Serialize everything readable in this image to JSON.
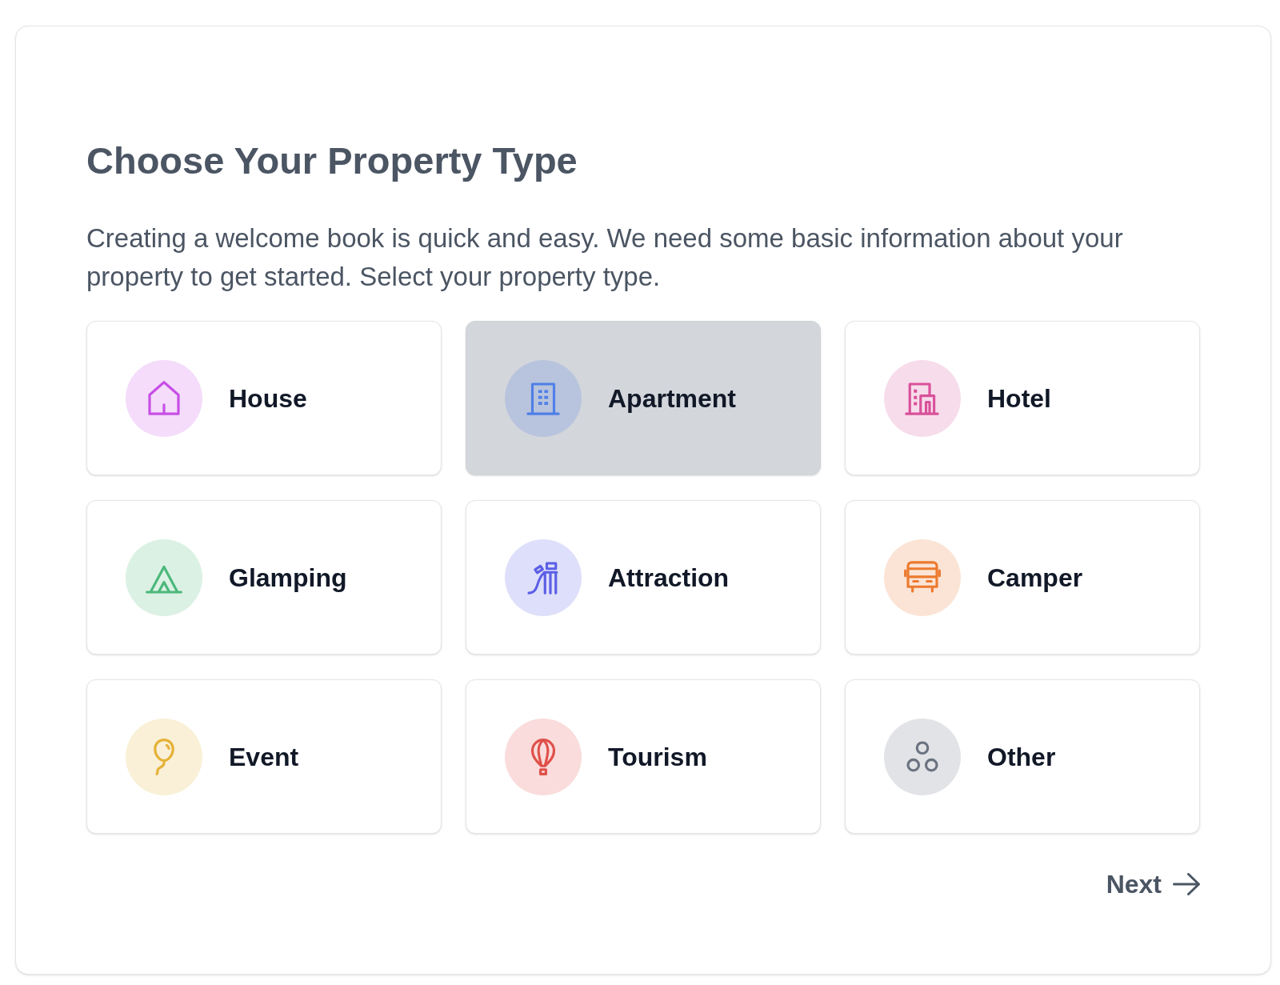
{
  "title": "Choose Your Property Type",
  "description": "Creating a welcome book is quick and easy. We need some basic information about your property to get started. Select your property type.",
  "property_types": [
    {
      "label": "House",
      "color": "#c74ee6",
      "selected": false
    },
    {
      "label": "Apartment",
      "color": "#4f7fe8",
      "selected": true
    },
    {
      "label": "Hotel",
      "color": "#d9519a",
      "selected": false
    },
    {
      "label": "Glamping",
      "color": "#4cb87a",
      "selected": false
    },
    {
      "label": "Attraction",
      "color": "#5b5fe6",
      "selected": false
    },
    {
      "label": "Camper",
      "color": "#ec7a2f",
      "selected": false
    },
    {
      "label": "Event",
      "color": "#e5b237",
      "selected": false
    },
    {
      "label": "Tourism",
      "color": "#e0504a",
      "selected": false
    },
    {
      "label": "Other",
      "color": "#6b7280",
      "selected": false
    }
  ],
  "next_button": {
    "label": "Next"
  }
}
